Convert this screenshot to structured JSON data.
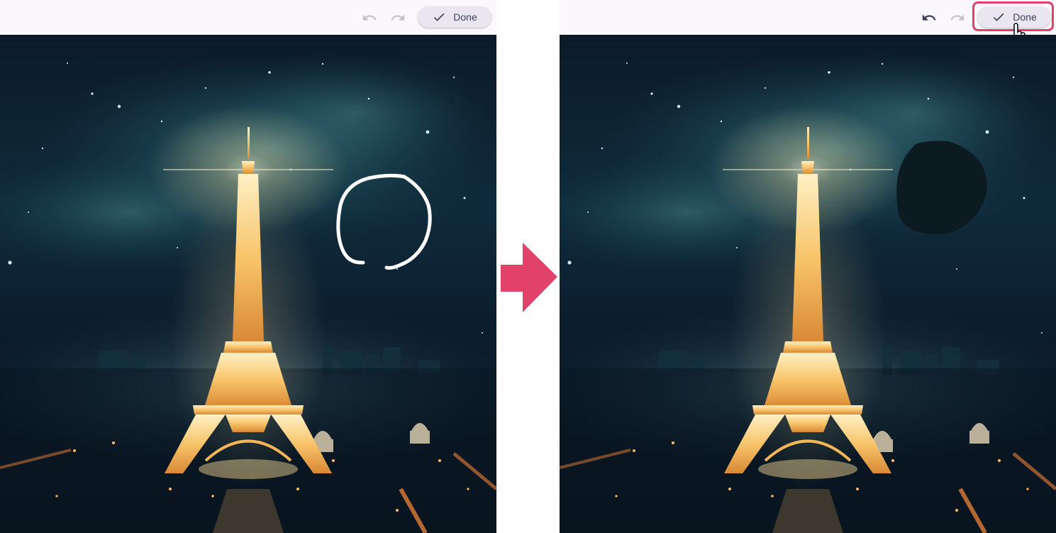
{
  "toolbar": {
    "done_label": "Done",
    "undo_icon": "undo-icon",
    "redo_icon": "redo-icon",
    "check_icon": "check-icon"
  },
  "panels": [
    {
      "state": "before",
      "mark": "white-circle-stroke"
    },
    {
      "state": "after",
      "mark": "dark-fill",
      "done_highlighted": true,
      "cursor": "pointer-hand-icon"
    }
  ],
  "colors": {
    "accent": "#e2416a",
    "toolbar_bg": "#fbf8fd",
    "done_bg": "#e9e6f0",
    "text": "#3f3f5a"
  }
}
